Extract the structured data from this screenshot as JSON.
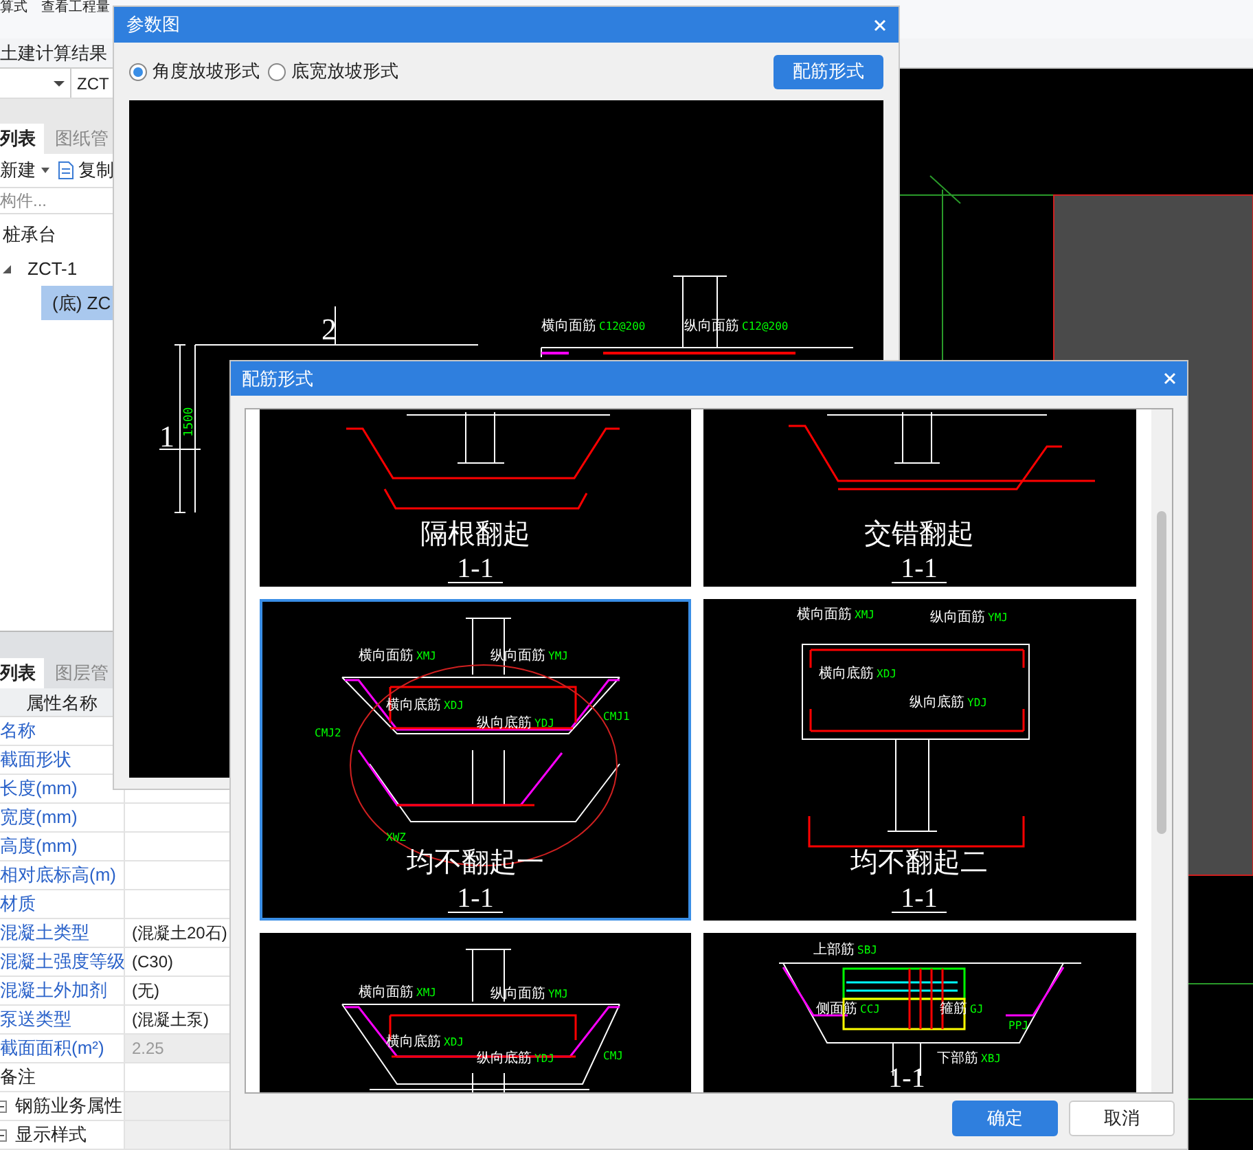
{
  "app": {
    "ribbon": [
      "算式",
      "查看工程量"
    ],
    "result_tab": "土建计算结果",
    "selector": {
      "value": "ZCT"
    },
    "upper_tabs": [
      {
        "label": "列表",
        "selected": true
      },
      {
        "label": "图纸管",
        "selected": false
      }
    ],
    "toolbar": [
      "新建",
      "复制"
    ],
    "search": {
      "placeholder": "构件..."
    },
    "tree": [
      {
        "label": "桩承台",
        "selected": false,
        "children": [
          {
            "label": "ZCT-1",
            "selected": false,
            "children": [
              {
                "label": "(底) ZC",
                "selected": true
              }
            ]
          }
        ]
      }
    ],
    "lower_tabs": [
      {
        "label": "列表",
        "selected": true
      },
      {
        "label": "图层管",
        "selected": false
      }
    ],
    "properties": {
      "header": "属性名称",
      "rows": [
        {
          "kind": "field",
          "name": "名称"
        },
        {
          "kind": "field",
          "name": "截面形状"
        },
        {
          "kind": "field",
          "name": "长度(mm)"
        },
        {
          "kind": "field",
          "name": "宽度(mm)"
        },
        {
          "kind": "field",
          "name": "高度(mm)"
        },
        {
          "kind": "field",
          "name": "相对底标高(m)"
        },
        {
          "kind": "field",
          "name": "材质"
        },
        {
          "kind": "field",
          "name": "混凝土类型",
          "value": "(混凝土20石)"
        },
        {
          "kind": "field",
          "name": "混凝土强度等级",
          "value": "(C30)"
        },
        {
          "kind": "field",
          "name": "混凝土外加剂",
          "value": "(无)"
        },
        {
          "kind": "field",
          "name": "泵送类型",
          "value": "(混凝土泵)"
        },
        {
          "kind": "field",
          "name": "截面面积(m²)",
          "value": "2.25",
          "disabled": true
        },
        {
          "kind": "note",
          "name": "备注"
        },
        {
          "kind": "group",
          "name": "钢筋业务属性"
        },
        {
          "kind": "group",
          "name": "显示样式"
        }
      ]
    }
  },
  "param_dialog": {
    "title": "参数图",
    "options": [
      {
        "label": "角度放坡形式",
        "selected": true
      },
      {
        "label": "底宽放坡形式",
        "selected": false
      }
    ],
    "button": "配筋形式",
    "diagram": {
      "marks": [
        "2",
        "1"
      ],
      "dimension": "1500",
      "labels": [
        {
          "text": "横向面筋",
          "code": "C12@200"
        },
        {
          "text": "纵向面筋",
          "code": "C12@200"
        }
      ]
    }
  },
  "rebar_dialog": {
    "title": "配筋形式",
    "options": [
      {
        "kind": "alternate",
        "caption": "隔根翻起",
        "section": "1-1",
        "selected": false
      },
      {
        "kind": "staggered",
        "caption": "交错翻起",
        "section": "1-1",
        "selected": false
      },
      {
        "kind": "flat-one",
        "caption": "均不翻起一",
        "section": "1-1",
        "selected": true,
        "labels": [
          {
            "text": "横向面筋",
            "code": "XMJ"
          },
          {
            "text": "纵向面筋",
            "code": "YMJ"
          },
          {
            "text": "横向底筋",
            "code": "XDJ"
          },
          {
            "text": "纵向底筋",
            "code": "YDJ"
          },
          {
            "code": "CMJ2"
          },
          {
            "code": "CMJ1"
          },
          {
            "code": "XWZ"
          }
        ]
      },
      {
        "kind": "flat-two",
        "caption": "均不翻起二",
        "section": "1-1",
        "selected": false,
        "labels": [
          {
            "text": "横向面筋",
            "code": "XMJ"
          },
          {
            "text": "纵向面筋",
            "code": "YMJ"
          },
          {
            "text": "横向底筋",
            "code": "XDJ"
          },
          {
            "text": "纵向底筋",
            "code": "YDJ"
          }
        ]
      },
      {
        "kind": "flat-three",
        "selected": false,
        "labels": [
          {
            "text": "横向面筋",
            "code": "XMJ"
          },
          {
            "text": "纵向面筋",
            "code": "YMJ"
          },
          {
            "text": "横向底筋",
            "code": "XDJ"
          },
          {
            "text": "纵向底筋",
            "code": "YDJ"
          },
          {
            "code": "CMJ"
          }
        ]
      },
      {
        "kind": "layered",
        "section": "1-1",
        "selected": false,
        "labels": [
          {
            "text": "上部筋",
            "code": "SBJ"
          },
          {
            "text": "侧面筋",
            "code": "CCJ"
          },
          {
            "text": "箍筋",
            "code": "GJ"
          },
          {
            "text": "下部筋",
            "code": "XBJ"
          },
          {
            "code": "PPJ"
          }
        ]
      }
    ],
    "buttons": [
      {
        "label": "确定",
        "kind": "primary"
      },
      {
        "label": "取消",
        "kind": "secondary"
      }
    ]
  }
}
